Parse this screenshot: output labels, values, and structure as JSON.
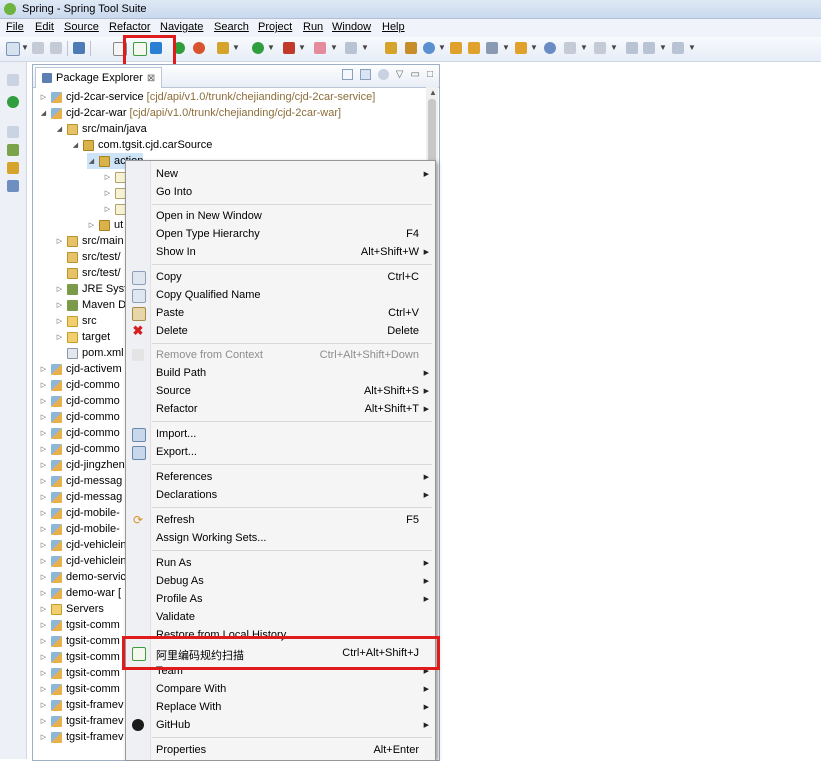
{
  "window": {
    "title": "Spring - Spring Tool Suite"
  },
  "menubar": [
    {
      "label": "File"
    },
    {
      "label": "Edit"
    },
    {
      "label": "Source"
    },
    {
      "label": "Refactor"
    },
    {
      "label": "Navigate"
    },
    {
      "label": "Search"
    },
    {
      "label": "Project"
    },
    {
      "label": "Run"
    },
    {
      "label": "Window"
    },
    {
      "label": "Help"
    }
  ],
  "colors": {
    "highlight": "#e01b1b",
    "accent": "#3a6ea5"
  },
  "package_explorer": {
    "tab_label": "Package Explorer",
    "tab_close": "⊠",
    "tree": [
      {
        "label": "cjd-2car-service",
        "path": "[cjd/api/v1.0/trunk/chejianding/cjd-2car-service]"
      },
      {
        "label": "cjd-2car-war",
        "path": "[cjd/api/v1.0/trunk/chejianding/cjd-2car-war]"
      },
      {
        "label": "src/main/java",
        "path": ""
      },
      {
        "label": "com.tgsit.cjd.carSource",
        "path": ""
      },
      {
        "label": "action",
        "path": ""
      },
      {
        "label": "",
        "path": ""
      },
      {
        "label": "",
        "path": ""
      },
      {
        "label": "",
        "path": ""
      },
      {
        "label": "ut",
        "path": ""
      },
      {
        "label": "src/main",
        "path": ""
      },
      {
        "label": "src/test/",
        "path": ""
      },
      {
        "label": "src/test/",
        "path": ""
      },
      {
        "label": "JRE Syste",
        "path": ""
      },
      {
        "label": "Maven D",
        "path": ""
      },
      {
        "label": "src",
        "path": ""
      },
      {
        "label": "target",
        "path": ""
      },
      {
        "label": "pom.xml",
        "path": ""
      },
      {
        "label": "cjd-activem",
        "path": ""
      },
      {
        "label": "cjd-commo",
        "path": ""
      },
      {
        "label": "cjd-commo",
        "path": ""
      },
      {
        "label": "cjd-commo",
        "path": ""
      },
      {
        "label": "cjd-commo",
        "path": ""
      },
      {
        "label": "cjd-commo",
        "path": ""
      },
      {
        "label": "cjd-jingzhen",
        "path": ""
      },
      {
        "label": "cjd-messag",
        "path": ""
      },
      {
        "label": "cjd-messag",
        "path": ""
      },
      {
        "label": "cjd-mobile-",
        "path": ""
      },
      {
        "label": "cjd-mobile-",
        "path": ""
      },
      {
        "label": "cjd-vehiclein",
        "path": ""
      },
      {
        "label": "cjd-vehiclein",
        "path": ""
      },
      {
        "label": "demo-servic",
        "path": ""
      },
      {
        "label": "demo-war [",
        "path": ""
      },
      {
        "label": "Servers",
        "path": ""
      },
      {
        "label": "tgsit-comm",
        "path": ""
      },
      {
        "label": "tgsit-comm",
        "path": ""
      },
      {
        "label": "tgsit-comm",
        "path": ""
      },
      {
        "label": "tgsit-comm",
        "path": ""
      },
      {
        "label": "tgsit-comm",
        "path": ""
      },
      {
        "label": "tgsit-framev",
        "path": ""
      },
      {
        "label": "tgsit-framev",
        "path": ""
      },
      {
        "label": "tgsit-framev",
        "path": ""
      }
    ]
  },
  "context_menu": {
    "items": [
      {
        "label": "New",
        "shortcut": ""
      },
      {
        "label": "Go Into",
        "shortcut": ""
      },
      {
        "label": "Open in New Window",
        "shortcut": ""
      },
      {
        "label": "Open Type Hierarchy",
        "shortcut": "F4"
      },
      {
        "label": "Show In",
        "shortcut": "Alt+Shift+W"
      },
      {
        "label": "Copy",
        "shortcut": "Ctrl+C"
      },
      {
        "label": "Copy Qualified Name",
        "shortcut": ""
      },
      {
        "label": "Paste",
        "shortcut": "Ctrl+V"
      },
      {
        "label": "Delete",
        "shortcut": "Delete"
      },
      {
        "label": "Remove from Context",
        "shortcut": "Ctrl+Alt+Shift+Down"
      },
      {
        "label": "Build Path",
        "shortcut": ""
      },
      {
        "label": "Source",
        "shortcut": "Alt+Shift+S"
      },
      {
        "label": "Refactor",
        "shortcut": "Alt+Shift+T"
      },
      {
        "label": "Import...",
        "shortcut": ""
      },
      {
        "label": "Export...",
        "shortcut": ""
      },
      {
        "label": "References",
        "shortcut": ""
      },
      {
        "label": "Declarations",
        "shortcut": ""
      },
      {
        "label": "Refresh",
        "shortcut": "F5"
      },
      {
        "label": "Assign Working Sets...",
        "shortcut": ""
      },
      {
        "label": "Run As",
        "shortcut": ""
      },
      {
        "label": "Debug As",
        "shortcut": ""
      },
      {
        "label": "Profile As",
        "shortcut": ""
      },
      {
        "label": "Validate",
        "shortcut": ""
      },
      {
        "label": "Restore from Local History...",
        "shortcut": ""
      },
      {
        "label": "阿里编码规约扫描",
        "shortcut": "Ctrl+Alt+Shift+J"
      },
      {
        "label": "Team",
        "shortcut": ""
      },
      {
        "label": "Compare With",
        "shortcut": ""
      },
      {
        "label": "Replace With",
        "shortcut": ""
      },
      {
        "label": "GitHub",
        "shortcut": ""
      },
      {
        "label": "Properties",
        "shortcut": "Alt+Enter"
      }
    ]
  },
  "icons": [
    "spring-icon",
    "new-icon",
    "save-icon",
    "save-all-icon",
    "print-icon",
    "search-icon",
    "p3c-scan-icon",
    "p3c-switch-icon",
    "debug-icon",
    "run-icon",
    "external-tools-icon",
    "back-icon",
    "forward-icon",
    "copy-icon",
    "paste-icon",
    "delete-icon",
    "import-icon",
    "export-icon",
    "refresh-icon",
    "github-icon"
  ]
}
